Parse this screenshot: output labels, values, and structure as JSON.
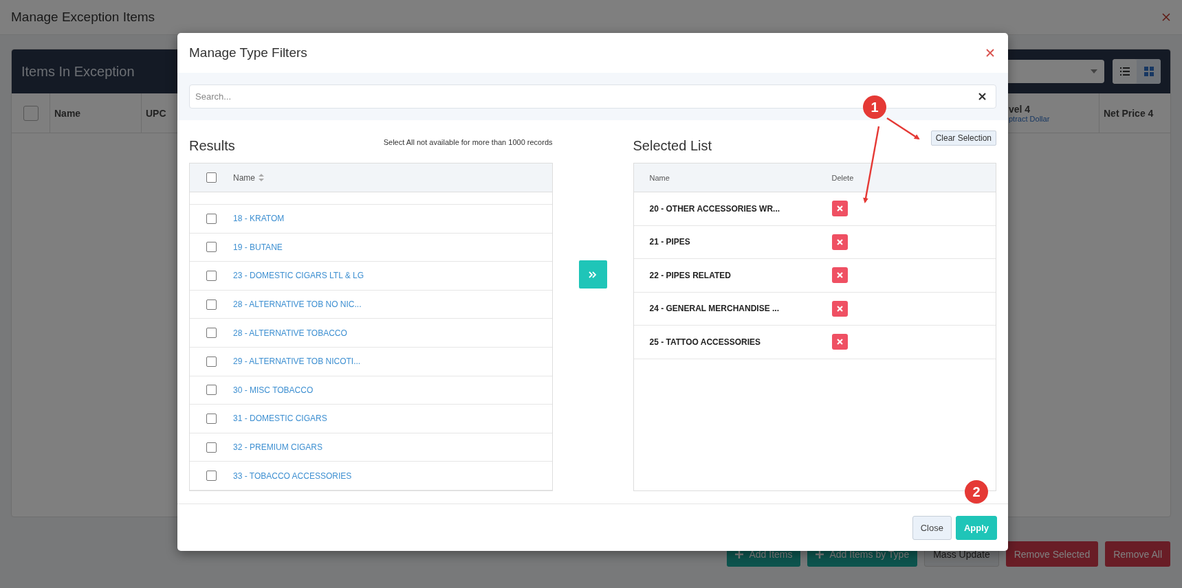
{
  "page": {
    "title": "Manage Exception Items"
  },
  "panel": {
    "title": "Items In Exception",
    "view_toggles": [
      {
        "kind": "list",
        "selected": false
      },
      {
        "kind": "grid",
        "selected": true
      }
    ],
    "select_all": {
      "checked": false
    },
    "columns": [
      {
        "title": "Name"
      },
      {
        "title": "UPC"
      },
      {
        "title": "vel 4",
        "subtitle": "ptract Dollar"
      },
      {
        "title": "Net Price 4"
      }
    ]
  },
  "actions": [
    {
      "label": "Add Items",
      "kind": "add"
    },
    {
      "label": "Add Items by Type",
      "kind": "add"
    },
    {
      "label": "Mass Update",
      "kind": "neutral"
    },
    {
      "label": "Remove Selected",
      "kind": "danger"
    },
    {
      "label": "Remove All",
      "kind": "danger"
    }
  ],
  "dialog": {
    "title": "Manage Type Filters",
    "search": {
      "placeholder": "Search..."
    },
    "results": {
      "title": "Results",
      "note": "Select All not available for more than 1000 records",
      "column": "Name",
      "select_all": {
        "checked": false
      },
      "rows": [
        {
          "name": "18 - KRATOM",
          "checked": false
        },
        {
          "name": "19 - BUTANE",
          "checked": false
        },
        {
          "name": "23 - DOMESTIC CIGARS LTL & LG",
          "checked": false
        },
        {
          "name": "28 - ALTERNATIVE TOB NO NIC...",
          "checked": false
        },
        {
          "name": "28 - ALTERNATIVE TOBACCO",
          "checked": false
        },
        {
          "name": "29 - ALTERNATIVE TOB NICOTI...",
          "checked": false
        },
        {
          "name": "30 - MISC TOBACCO",
          "checked": false
        },
        {
          "name": "31 - DOMESTIC CIGARS",
          "checked": false
        },
        {
          "name": "32 - PREMIUM CIGARS",
          "checked": false
        },
        {
          "name": "33 - TOBACCO ACCESSORIES",
          "checked": false
        }
      ]
    },
    "selected_list": {
      "title": "Selected List",
      "clear_button": "Clear Selection",
      "columns": [
        "Name",
        "Delete"
      ],
      "rows": [
        {
          "name": "20 - OTHER ACCESSORIES WR..."
        },
        {
          "name": "21 - PIPES"
        },
        {
          "name": "22 - PIPES RELATED"
        },
        {
          "name": "24 - GENERAL MERCHANDISE ..."
        },
        {
          "name": "25 - TATTOO ACCESSORIES"
        }
      ]
    },
    "buttons": [
      {
        "label": "Close",
        "kind": "secondary"
      },
      {
        "label": "Apply",
        "kind": "primary"
      }
    ]
  },
  "annotations": [
    {
      "label": "1"
    },
    {
      "label": "2"
    }
  ]
}
